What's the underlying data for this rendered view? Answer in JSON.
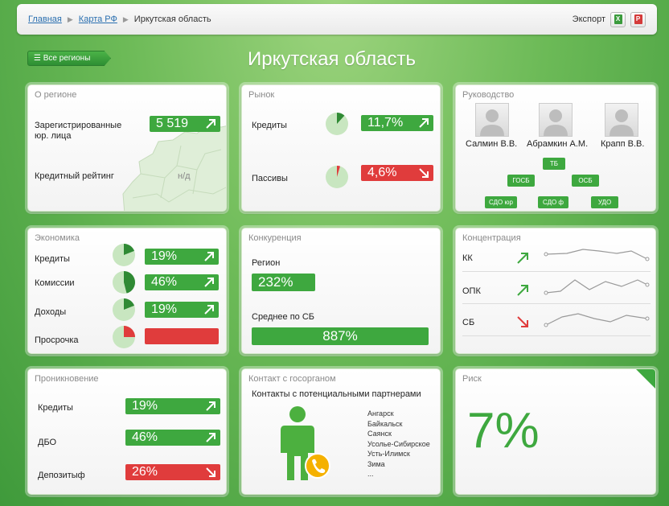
{
  "breadcrumb": {
    "home": "Главная",
    "map": "Карта РФ",
    "current": "Иркутская область"
  },
  "export": {
    "label": "Экспорт",
    "excel_icon": "excel-icon",
    "pdf_icon": "pdf-icon"
  },
  "header": {
    "all_regions": "☰ Все регионы",
    "title": "Иркутская область"
  },
  "about": {
    "title": "О регионе",
    "registered_label": "Зарегистрированные юр. лица",
    "registered_value": "5 519",
    "rating_label": "Кредитный рейтинг",
    "rating_value": "н/д"
  },
  "market": {
    "title": "Рынок",
    "credits_label": "Кредиты",
    "credits_value": "11,7%",
    "credits_share": 0.117,
    "liabilities_label": "Пассивы",
    "liabilities_value": "4,6%",
    "liabilities_share": 0.046
  },
  "management": {
    "title": "Руководство",
    "people": [
      "Салмин В.В.",
      "Абрамкин А.М.",
      "Крапп В.В."
    ],
    "tags": [
      "ТБ",
      "ГОСБ",
      "ОСБ",
      "СДО юр",
      "СДО ф",
      "УДО"
    ]
  },
  "economy": {
    "title": "Экономика",
    "rows": [
      {
        "label": "Кредиты",
        "value": "19%",
        "share": 0.19
      },
      {
        "label": "Комиссии",
        "value": "46%",
        "share": 0.46
      },
      {
        "label": "Доходы",
        "value": "19%",
        "share": 0.19
      },
      {
        "label": "Просрочка",
        "value": "",
        "share": 0.25
      }
    ]
  },
  "competition": {
    "title": "Конкуренция",
    "region_label": "Регион",
    "region_value": "232%",
    "avg_label": "Среднее по СБ",
    "avg_value": "887%"
  },
  "concentration": {
    "title": "Концентрация",
    "rows": [
      {
        "label": "КК",
        "trend": "up"
      },
      {
        "label": "ОПК",
        "trend": "up"
      },
      {
        "label": "СБ",
        "trend": "down"
      }
    ]
  },
  "penetration": {
    "title": "Проникновение",
    "rows": [
      {
        "label": "Кредиты",
        "value": "19%",
        "trend": "up"
      },
      {
        "label": "ДБО",
        "value": "46%",
        "trend": "up"
      },
      {
        "label": "Депозитыф",
        "value": "26%",
        "trend": "down"
      }
    ]
  },
  "gov_contact": {
    "title": "Контакт с госорганом",
    "subtitle": "Контакты с потенциальными партнерами",
    "cities": [
      "Ангарск",
      "Байкальск",
      "Саянск",
      "Усолье-Сибирское",
      "Усть-Илимск",
      "Зима",
      "..."
    ]
  },
  "risk": {
    "title": "Риск",
    "value": "7%"
  },
  "colors": {
    "green": "#3ea83f",
    "red": "#e03c3c",
    "pie_light": "#c8e6c0",
    "pie_dark": "#2f8a34"
  }
}
